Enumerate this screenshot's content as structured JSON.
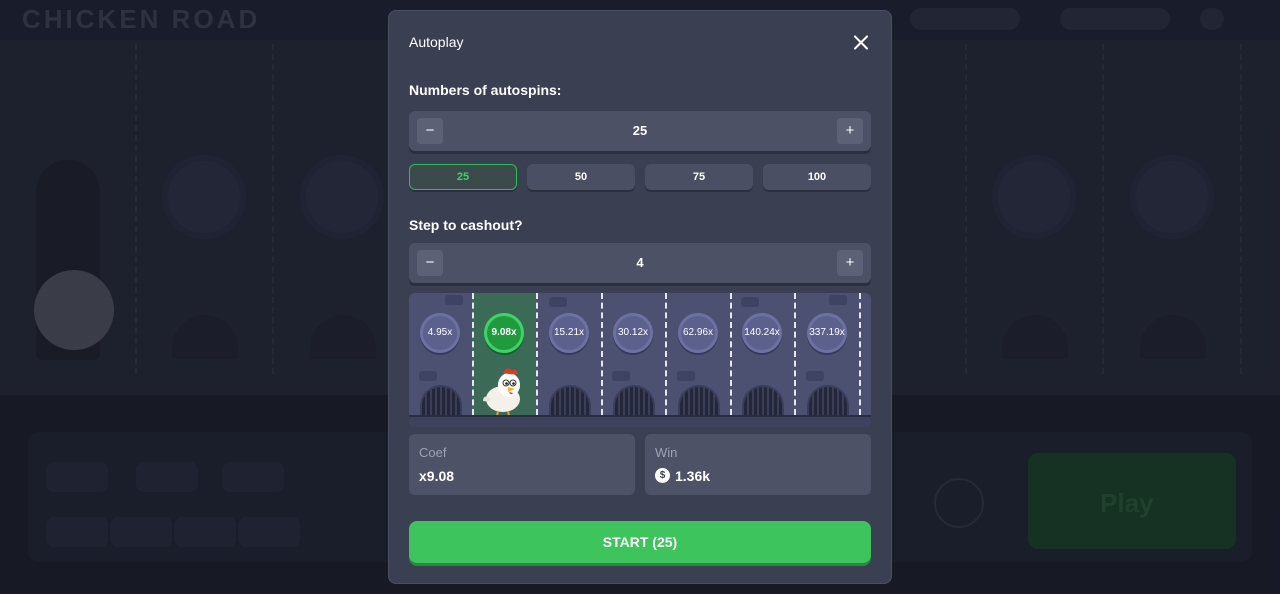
{
  "background": {
    "logo": "CHICKEN ROAD",
    "play_label": "Play"
  },
  "modal": {
    "title": "Autoplay",
    "autospins": {
      "label": "Numbers of autospins:",
      "value": "25",
      "minus": "−",
      "plus": "+",
      "presets": [
        "25",
        "50",
        "75",
        "100"
      ],
      "selected": "25"
    },
    "cashout": {
      "label": "Step to cashout?",
      "value": "4",
      "minus": "−",
      "plus": "+"
    },
    "road": {
      "multipliers": [
        "4.95x",
        "9.08x",
        "15.21x",
        "30.12x",
        "62.96x",
        "140.24x",
        "337.19x"
      ],
      "active_index": 1
    },
    "coef": {
      "label": "Coef",
      "value": "x9.08"
    },
    "win": {
      "label": "Win",
      "currency_symbol": "$",
      "value": "1.36k"
    },
    "start_label": "START (25)"
  },
  "colors": {
    "accent_green": "#3ec45c",
    "modal_bg": "#3b3f52"
  }
}
